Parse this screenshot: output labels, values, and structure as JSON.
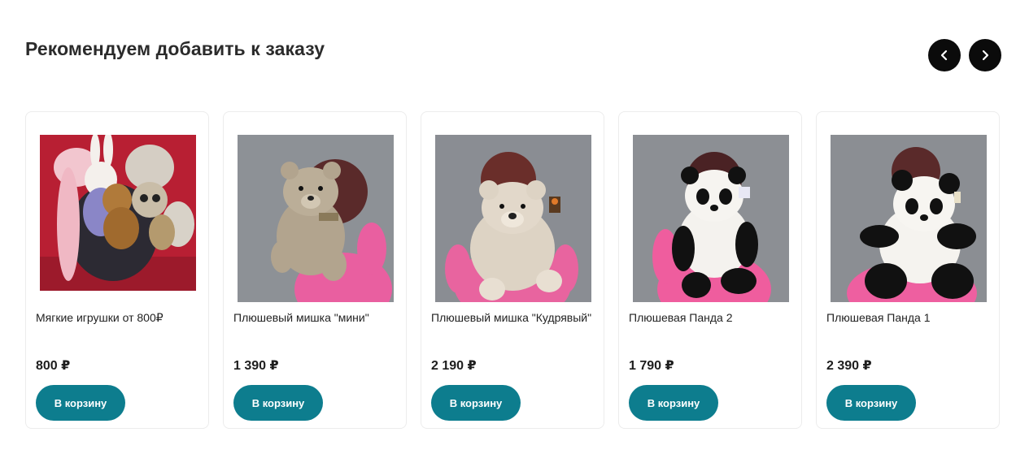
{
  "section": {
    "title": "Рекомендуем добавить к заказу"
  },
  "carousel": {
    "prev_icon": "chevron-left-icon",
    "next_icon": "chevron-right-icon"
  },
  "products": [
    {
      "name": "Мягкие игрушки от 800₽",
      "price": "800 ₽",
      "button": "В корзину",
      "image": "plush-toys-bundle"
    },
    {
      "name": "Плюшевый мишка \"мини\"",
      "price": "1 390 ₽",
      "button": "В корзину",
      "image": "bear-mini"
    },
    {
      "name": "Плюшевый мишка \"Кудрявый\"",
      "price": "2 190 ₽",
      "button": "В корзину",
      "image": "bear-curly"
    },
    {
      "name": "Плюшевая Панда 2",
      "price": "1 790 ₽",
      "button": "В корзину",
      "image": "panda-2"
    },
    {
      "name": "Плюшевая Панда 1",
      "price": "2 390 ₽",
      "button": "В корзину",
      "image": "panda-1"
    }
  ],
  "colors": {
    "accent": "#0d7d8e",
    "nav_button": "#0b0b0b",
    "card_border": "#ececec"
  }
}
